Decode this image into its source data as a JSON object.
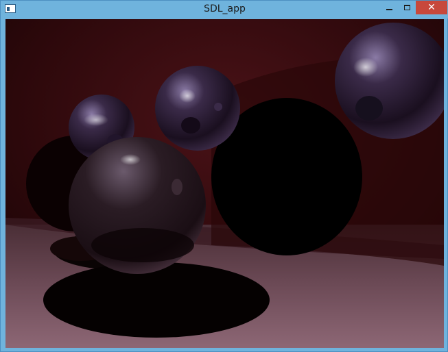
{
  "window": {
    "title": "SDL_app",
    "controls": {
      "minimize": "minimize",
      "maximize": "maximize",
      "close": "close"
    }
  },
  "scene": {
    "description_icon": "raytraced-render",
    "colors": {
      "wall_dark": "#1a0406",
      "wall_mid": "#3b0c10",
      "floor_light": "#8a6470",
      "floor_mid": "#5a3a46",
      "sphere_tint": "#8e7aaa"
    }
  }
}
